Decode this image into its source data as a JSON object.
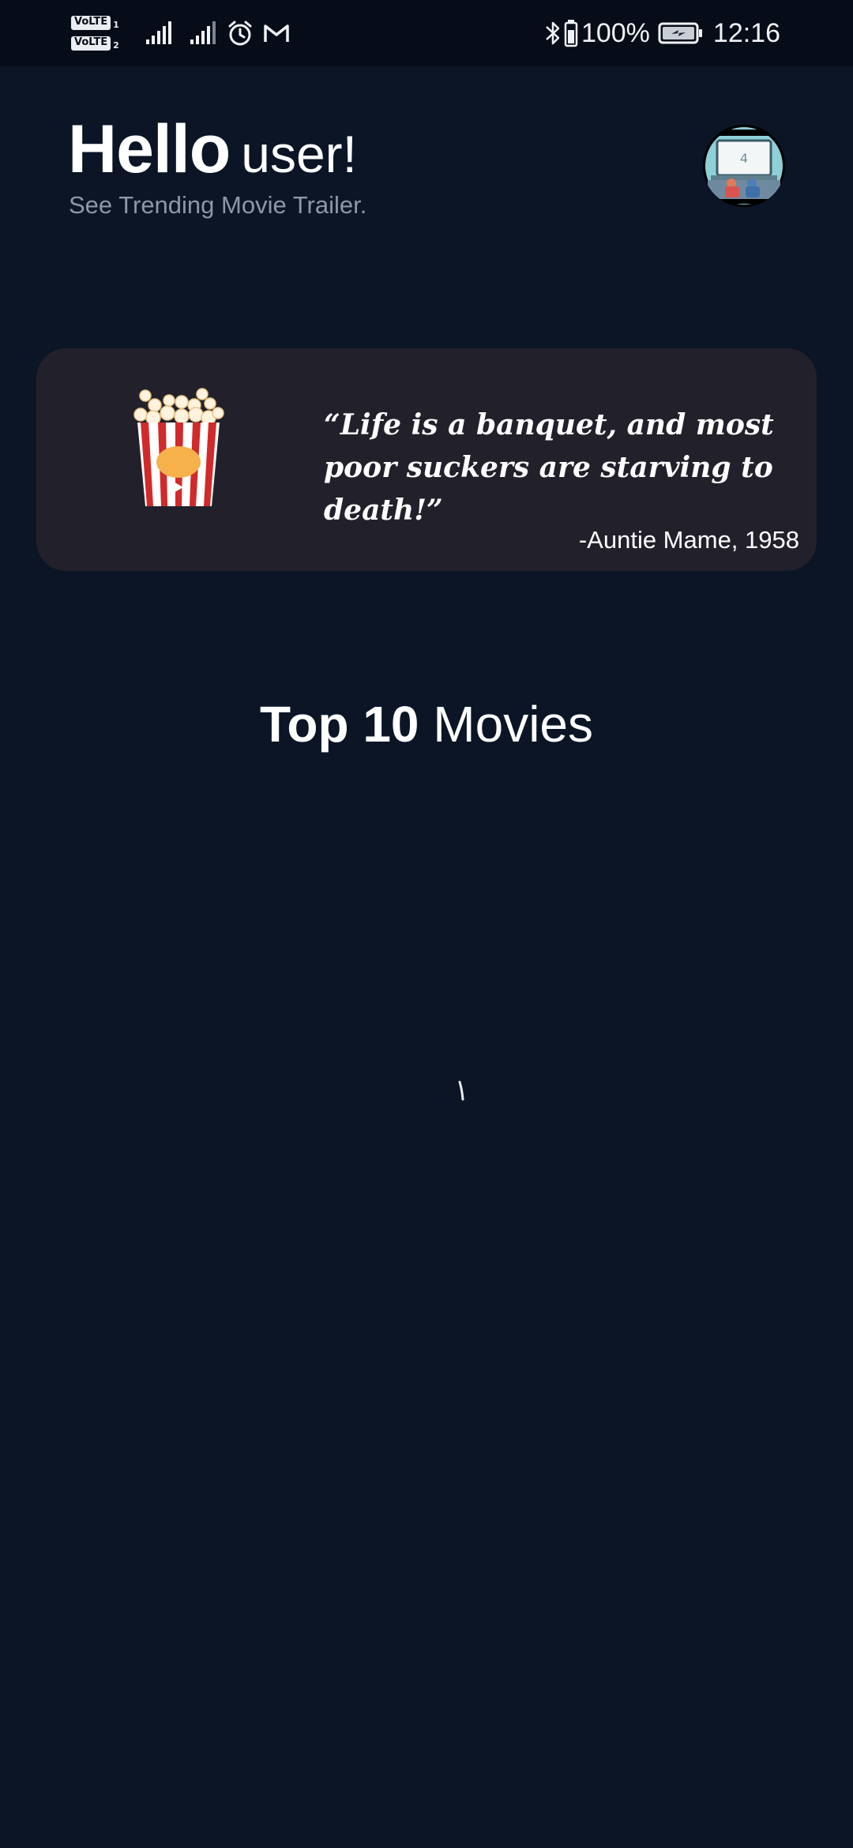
{
  "status_bar": {
    "sim1_label": "VoLTE",
    "sim1_index": "1",
    "sim2_label": "VoLTE",
    "sim2_index": "2",
    "battery_percent": "100%",
    "time": "12:16",
    "icons": [
      "signal-icon",
      "signal-icon",
      "alarm-icon",
      "gmail-icon",
      "bluetooth-icon",
      "battery-icon",
      "charging-battery-icon"
    ]
  },
  "header": {
    "greeting_bold": "Hello",
    "greeting_name": "user!",
    "subtitle": "See Trending Movie Trailer."
  },
  "quote_card": {
    "quote": "“Life is a banquet, and most poor suckers are starving to death!”",
    "author": "-Auntie Mame, 1958"
  },
  "section": {
    "title_bold": "Top 10",
    "title_light": "Movies"
  },
  "colors": {
    "background": "#0b1526",
    "status_bar": "#060d18",
    "card": "#22212b",
    "subtitle": "#8d97a8"
  }
}
